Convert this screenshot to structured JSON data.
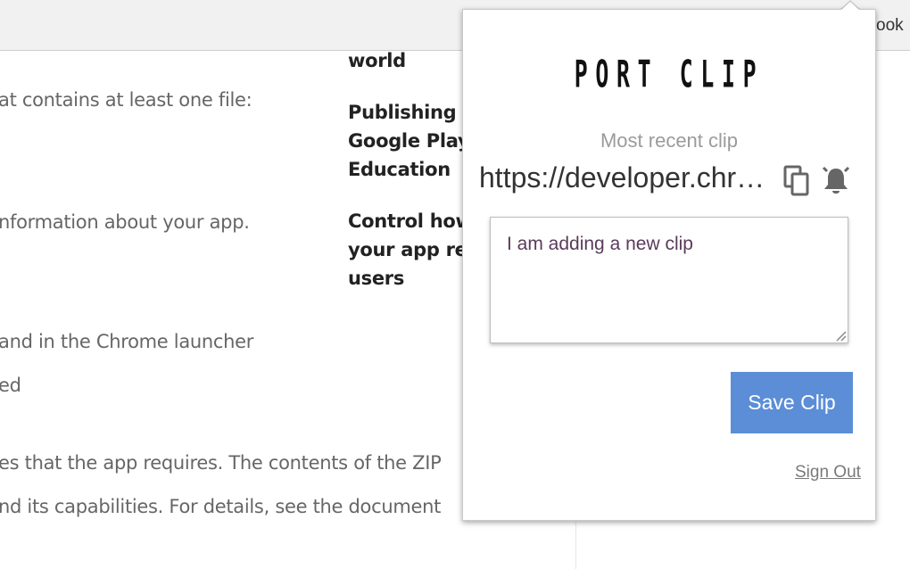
{
  "toolbar": {
    "partial_text": "ook"
  },
  "background": {
    "lines": [
      "at contains at least one file:",
      "nformation about your app.",
      "and in the Chrome launcher",
      "ed",
      "es that the app requires. The contents of the ZIP",
      "nd its capabilities. For details, see the document"
    ],
    "side_headings": [
      [
        "world"
      ],
      [
        "Publishing c",
        "Google Play",
        "Education"
      ],
      [
        "Control how",
        "your app re",
        "users"
      ]
    ]
  },
  "popup": {
    "logo": "PORT CLIP",
    "recent_label": "Most recent clip",
    "recent_url": "https://developer.chrome.com/apps/first_app",
    "copy_icon": "copy-icon",
    "bell_icon": "bell-icon",
    "clip_text": "I am adding a new clip",
    "save_label": "Save Clip",
    "sign_out_label": "Sign Out",
    "colors": {
      "accent": "#5b8ed6",
      "muted_text": "#9b9b9b"
    }
  }
}
